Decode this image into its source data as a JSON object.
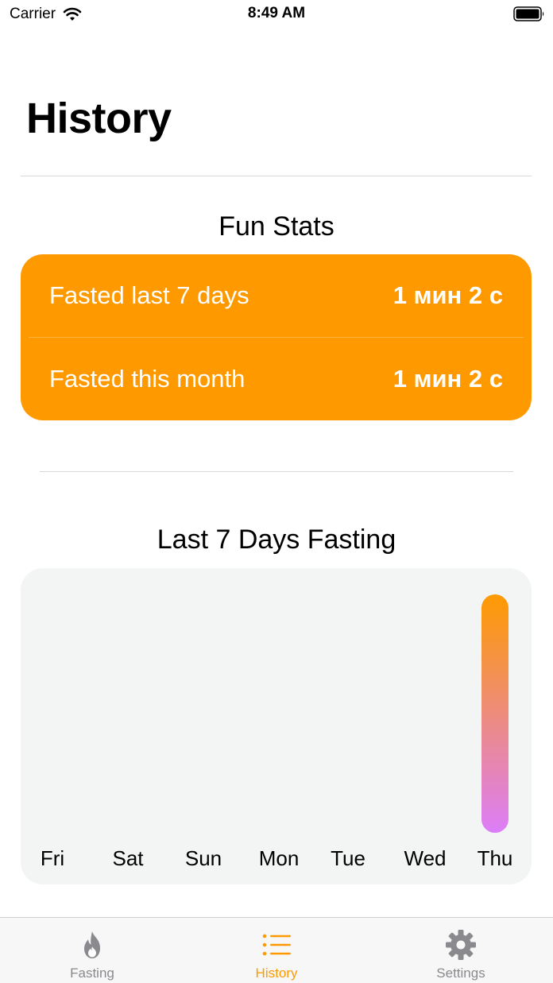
{
  "status_bar": {
    "carrier": "Carrier",
    "time": "8:49 AM"
  },
  "page": {
    "title": "History"
  },
  "fun_stats": {
    "title": "Fun Stats",
    "rows": [
      {
        "label": "Fasted last 7 days",
        "value": "1 мин 2 с"
      },
      {
        "label": "Fasted this month",
        "value": "1 мин 2 с"
      }
    ],
    "card_color": "#FE9A00"
  },
  "chart_data": {
    "type": "bar",
    "title": "Last 7 Days Fasting",
    "categories": [
      "Fri",
      "Sat",
      "Sun",
      "Mon",
      "Tue",
      "Wed",
      "Thu"
    ],
    "values": [
      0,
      0,
      0,
      0,
      0,
      0,
      1
    ],
    "xlabel": "",
    "ylabel": "",
    "grid": false,
    "bar_gradient": [
      "#FE9A00",
      "#DC7EF8"
    ]
  },
  "tab_bar": {
    "items": [
      {
        "label": "Fasting",
        "icon": "flame-icon",
        "active": false
      },
      {
        "label": "History",
        "icon": "list-icon",
        "active": true
      },
      {
        "label": "Settings",
        "icon": "gear-icon",
        "active": false
      }
    ],
    "active_color": "#FE9A00",
    "inactive_color": "#8A8A8E"
  }
}
